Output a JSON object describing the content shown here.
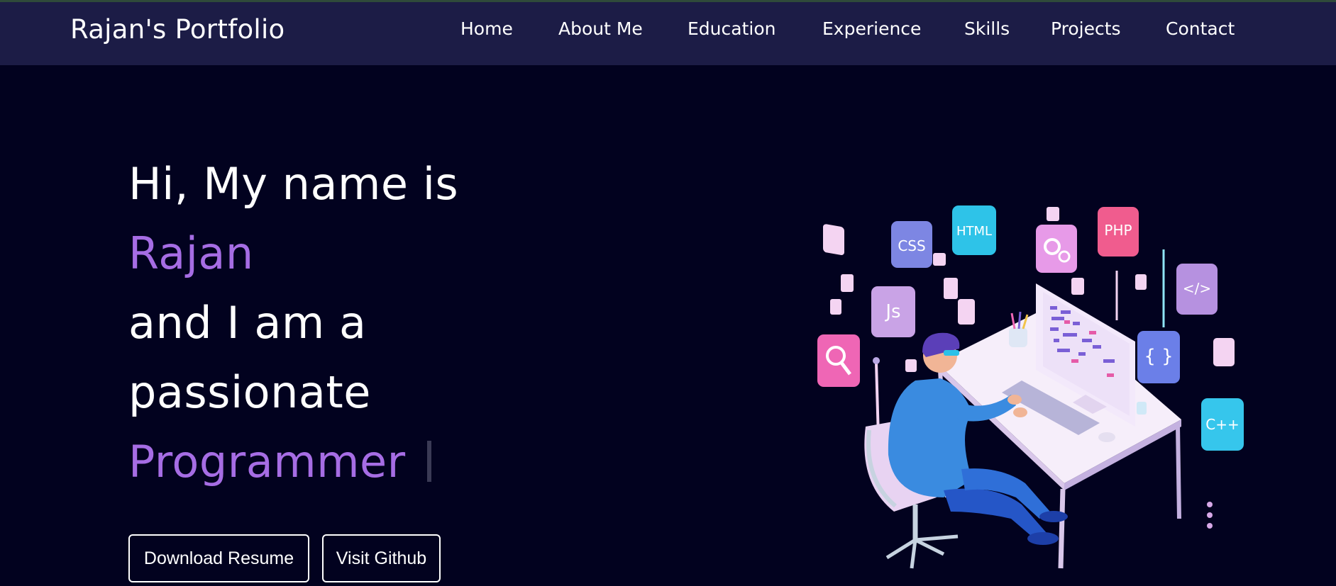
{
  "nav": {
    "brand": "Rajan's Portfolio",
    "links": [
      "Home",
      "About Me",
      "Education",
      "Experience",
      "Skills",
      "Projects",
      "Contact"
    ]
  },
  "hero": {
    "line1": "Hi, My name is",
    "name": "Rajan",
    "line3": "and I am a",
    "line4": "passionate",
    "role": "Programmer"
  },
  "buttons": {
    "resume": "Download Resume",
    "github": "Visit Github"
  },
  "illustration": {
    "tiles": [
      "CSS",
      "HTML",
      "PHP",
      "Js",
      "{ }",
      "</>",
      "C++"
    ]
  },
  "colors": {
    "background": "#02021f",
    "navbar": "#1c1c46",
    "accent": "#a66de4"
  }
}
